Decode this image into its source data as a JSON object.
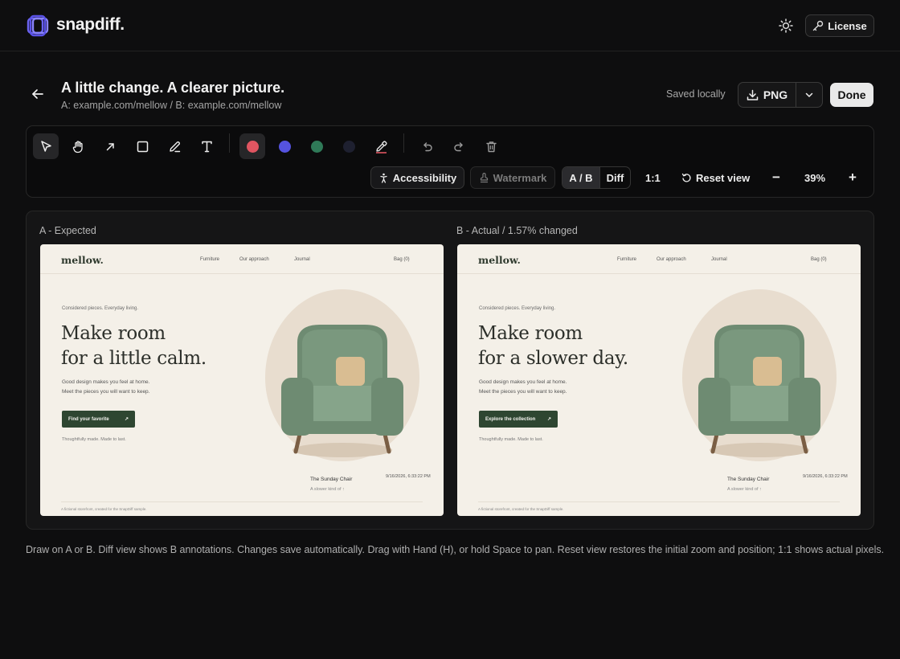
{
  "app": {
    "brand": "snapdiff.",
    "license_label": "License"
  },
  "header": {
    "title": "A little change. A clearer picture.",
    "subtitle": "A: example.com/mellow / B: example.com/mellow",
    "saved_status": "Saved locally",
    "export_label": "PNG",
    "done_label": "Done"
  },
  "toolbar": {
    "tools": [
      "select-icon",
      "hand-icon",
      "arrow-icon",
      "rectangle-icon",
      "pen-icon",
      "text-icon"
    ],
    "colors": [
      "#e05561",
      "#5553e0",
      "#2f7a58",
      "#1e2030"
    ],
    "accessibility_label": "Accessibility",
    "watermark_label": "Watermark",
    "view_ab": "A / B",
    "view_diff": "Diff",
    "actual_size": "1:1",
    "reset_view": "Reset view",
    "zoom": "39%",
    "zoom_out": "−",
    "zoom_in": "+"
  },
  "compare": {
    "a": {
      "label": "A - Expected",
      "site": {
        "logo": "mellow.",
        "nav": [
          "Furniture",
          "Our approach",
          "Journal"
        ],
        "bag": "Bag (0)",
        "eyebrow": "Considered pieces. Everyday living.",
        "headline_1": "Make room",
        "headline_2": "for a little calm.",
        "body_1": "Good design makes you feel at home.",
        "body_2": "Meet the pieces you will want to keep.",
        "cta": "Find your favorite",
        "cta_arrow": "↗",
        "small": "Thoughtfully made. Made to last.",
        "timestamp": "9/16/2026, 6:33:22 PM",
        "product_name": "The Sunday Chair",
        "product_tag": "A slower kind of ↑",
        "footer": "A fictional storefront, created for the SnapDiff sample."
      }
    },
    "b": {
      "label": "B - Actual / 1.57% changed",
      "site": {
        "logo": "mellow.",
        "nav": [
          "Furniture",
          "Our approach",
          "Journal"
        ],
        "bag": "Bag (0)",
        "eyebrow": "Considered pieces. Everyday living.",
        "headline_1": "Make room",
        "headline_2": "for a slower day.",
        "body_1": "Good design makes you feel at home.",
        "body_2": "Meet the pieces you will want to keep.",
        "cta": "Explore the collection",
        "cta_arrow": "↗",
        "small": "Thoughtfully made. Made to last.",
        "timestamp": "9/16/2026, 6:33:22 PM",
        "product_name": "The Sunday Chair",
        "product_tag": "A slower kind of ↑",
        "footer": "A fictional storefront, created for the SnapDiff sample."
      }
    }
  },
  "help_text": "Draw on A or B. Diff view shows B annotations. Changes save automatically. Drag with Hand (H), or hold Space to pan. Reset view restores the initial zoom and position; 1:1 shows actual pixels."
}
